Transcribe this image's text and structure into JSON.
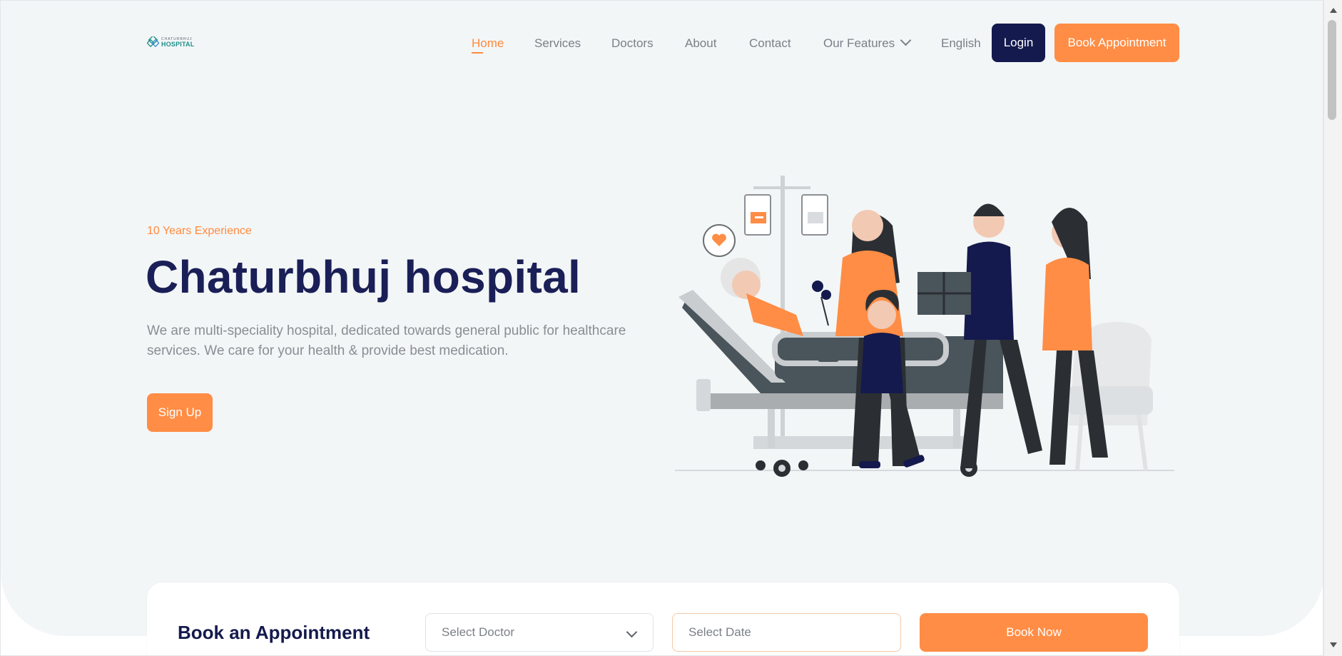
{
  "brand": {
    "logo_top": "CHATURBHUJ",
    "logo_main": "HOSPITAL",
    "accent": "#ff8d45",
    "navy": "#141a4d",
    "teal": "#1e8f8a"
  },
  "nav": {
    "items": [
      {
        "label": "Home",
        "active": true
      },
      {
        "label": "Services"
      },
      {
        "label": "Doctors"
      },
      {
        "label": "About"
      },
      {
        "label": "Contact"
      },
      {
        "label": "Our Features",
        "icon": "chevron-down-icon"
      },
      {
        "label": "English"
      }
    ],
    "login_label": "Login",
    "book_label": "Book Appointment"
  },
  "hero": {
    "eyebrow": "10 Years Experience",
    "title": "Chaturbhuj hospital",
    "description": "We are multi-speciality hospital, dedicated towards general public for healthcare services. We care for your health & provide best medication.",
    "signup_label": "Sign Up"
  },
  "appointment": {
    "title": "Book an Appointment",
    "doctor_placeholder": "Select Doctor",
    "date_placeholder": "Select Date",
    "book_now_label": "Book Now"
  }
}
